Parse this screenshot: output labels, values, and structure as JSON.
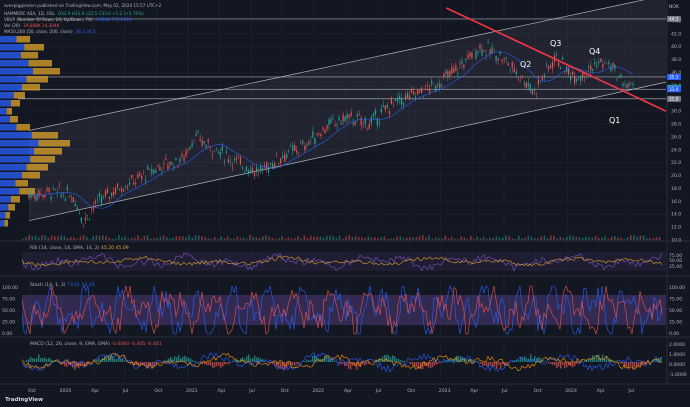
{
  "header": {
    "publisher": "svevpiggimann published on TradingView.com, May 02, 2024 15:57 UTC+2",
    "symbol_line": "HAMMERC ASA, 1D, OSL",
    "symbol_values": "O33.9 H33.9 L32.5 C33.6 +1.2 (+3.76%)",
    "vbvp_line": "VBVP (Number Of Rows, 24, Up/Down, 70)",
    "vbvp_values": "3.396K  771.911K",
    "vol_line": "Vol (20)",
    "vol_values": "19.808K  14.304K",
    "ma_line": "MA50,200 (50, close, 200, close)",
    "ma_values": "36.2  34.5",
    "currency": "NOK"
  },
  "annotations": {
    "q1": "Q1",
    "q2": "Q2",
    "q3": "Q3",
    "q4": "Q4"
  },
  "price_axis": {
    "ticks": [
      "44.0",
      "42.0",
      "40.0",
      "38.0",
      "36.0",
      "34.0",
      "32.0",
      "30.0",
      "28.0",
      "26.0",
      "24.0",
      "22.0",
      "20.0",
      "18.0",
      "16.0",
      "14.0",
      "12.0",
      "10.0"
    ],
    "tags": [
      {
        "label": "44.3",
        "color": "#787b86"
      },
      {
        "label": "35.3",
        "color": "#2962ff"
      },
      {
        "label": "33.6",
        "color": "#26a69a"
      },
      {
        "label": "33.4",
        "color": "#2962ff"
      },
      {
        "label": "31.9",
        "color": "#787b86"
      }
    ]
  },
  "time_axis": {
    "labels": [
      "Oct",
      "2020",
      "Apr",
      "Jul",
      "Oct",
      "2021",
      "Apr",
      "Jul",
      "Oct",
      "2022",
      "Apr",
      "Jul",
      "Oct",
      "2023",
      "Apr",
      "Jul",
      "Oct",
      "2024",
      "Apr",
      "Jul"
    ]
  },
  "rsi": {
    "title": "RSI (14, close, 14, SMA, 14, 2)",
    "values": "45.20  45.09",
    "ticks": [
      "75.00",
      "50.00",
      "25.00"
    ]
  },
  "stoch": {
    "title": "Stoch (14, 1, 3)",
    "values": "73.01  52.45",
    "ticks": [
      "100.00",
      "75.00",
      "50.00",
      "25.00",
      "0.00"
    ],
    "left_ticks": [
      "100.00",
      "75.00",
      "50.00",
      "25.00",
      "0.00"
    ]
  },
  "macd": {
    "title": "MACD (12, 26, close, 9, EMA, EMA)",
    "values": "-0.0093  -0.405  -0.401",
    "ticks": [
      "2.0000",
      "1.0000",
      "0.0000",
      "-1.0000"
    ]
  },
  "branding": "TradingView",
  "chart_data": {
    "type": "line",
    "title": "",
    "xlabel": "",
    "ylabel": "",
    "x_range": [
      "2019-09",
      "2024-08"
    ],
    "ylim": [
      10,
      46
    ],
    "price_series": {
      "name": "",
      "x": [
        "2019-10",
        "2019-12",
        "2020-02",
        "2020-03",
        "2020-04",
        "2020-06",
        "2020-08",
        "2020-10",
        "2020-12",
        "2021-01",
        "2021-03",
        "2021-05",
        "2021-07",
        "2021-09",
        "2021-11",
        "2022-01",
        "2022-03",
        "2022-05",
        "2022-07",
        "2022-09",
        "2022-11",
        "2023-01",
        "2023-03",
        "2023-05",
        "2023-07",
        "2023-08",
        "2023-09",
        "2023-10",
        "2023-11",
        "2023-12",
        "2024-01",
        "2024-02",
        "2024-03",
        "2024-04",
        "2024-05"
      ],
      "values": [
        17.0,
        17.5,
        16.8,
        13.0,
        15.5,
        18.0,
        19.5,
        21.5,
        22.5,
        26.0,
        24.0,
        22.0,
        20.5,
        23.0,
        24.5,
        27.5,
        29.0,
        28.0,
        31.0,
        32.5,
        34.0,
        36.5,
        40.0,
        38.5,
        35.0,
        33.0,
        36.0,
        38.5,
        36.0,
        35.5,
        36.5,
        37.5,
        37.0,
        34.5,
        33.6
      ]
    },
    "horizontal_levels": [
      44.3,
      35.3,
      33.4,
      31.9
    ],
    "trend_channel": {
      "lower_start": [
        "2019-10",
        13.0
      ],
      "lower_end": [
        "2024-08",
        34.5
      ],
      "upper_start": [
        "2019-10",
        27.0
      ],
      "upper_end": [
        "2024-08",
        48.0
      ]
    },
    "downtrend_line": {
      "start": [
        "2022-12",
        46.0
      ],
      "end": [
        "2024-08",
        30.0
      ]
    },
    "grid": true,
    "legend": "top-left"
  }
}
